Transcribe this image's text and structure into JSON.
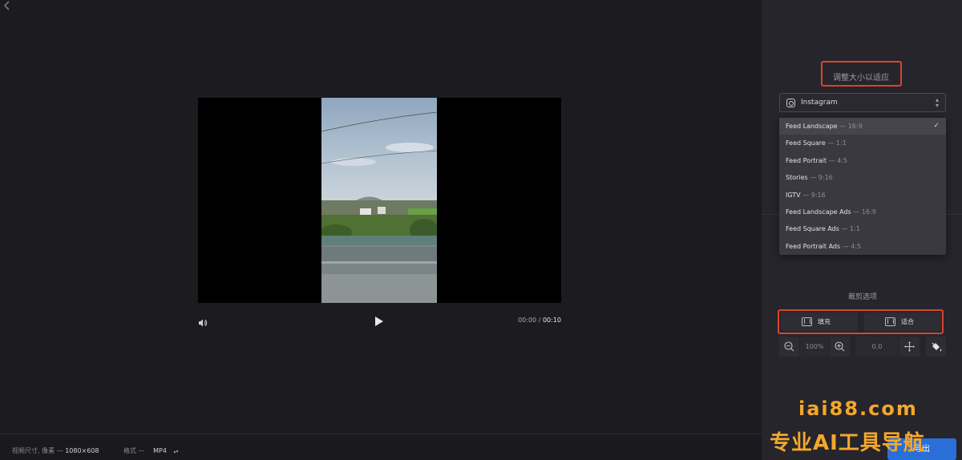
{
  "player": {
    "current_time": "00:00",
    "separator": "/",
    "total_time": "00:10"
  },
  "side": {
    "resize_title": "调整大小以适应",
    "platform": {
      "label": "Instagram",
      "icon": "instagram-icon"
    },
    "formats": [
      {
        "name": "Feed Landscape",
        "ratio": "— 16:9",
        "selected": true
      },
      {
        "name": "Feed Square",
        "ratio": "— 1:1",
        "selected": false
      },
      {
        "name": "Feed Portrait",
        "ratio": "— 4:5",
        "selected": false
      },
      {
        "name": "Stories",
        "ratio": "— 9:16",
        "selected": false
      },
      {
        "name": "IGTV",
        "ratio": "— 9:16",
        "selected": false
      },
      {
        "name": "Feed Landscape Ads",
        "ratio": "— 16:9",
        "selected": false
      },
      {
        "name": "Feed Square Ads",
        "ratio": "— 1:1",
        "selected": false
      },
      {
        "name": "Feed Portrait Ads",
        "ratio": "— 4:5",
        "selected": false
      }
    ],
    "crop_title": "裁剪选项",
    "crop_fill": "填充",
    "crop_fit": "适合",
    "zoom_value": "100%",
    "position_value": "0,0"
  },
  "footer": {
    "dim_label": "视频尺寸, 像素 —",
    "dim_value": "1080×608",
    "format_label": "格式 —",
    "format_value": "MP4"
  },
  "export_label": "导出",
  "watermark": {
    "url": "iai88.com",
    "text": "专业AI工具导航"
  },
  "colors": {
    "accent": "#2a6fd8",
    "highlight": "#d9442f",
    "watermark": "#f4a72c"
  }
}
